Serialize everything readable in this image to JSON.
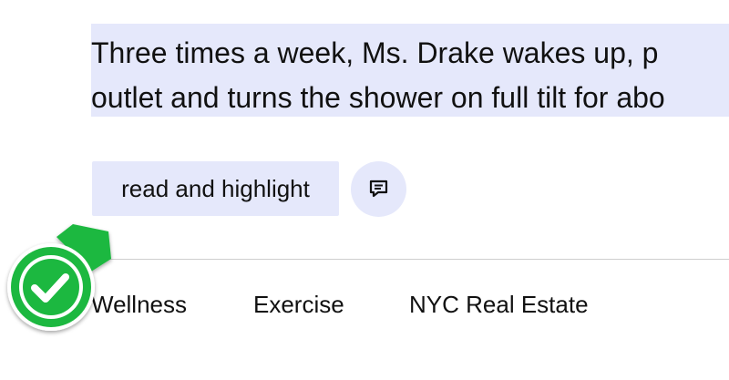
{
  "article": {
    "highlighted_lines": [
      "Three times a week, Ms. Drake wakes up, p",
      "outlet and turns the shower on full tilt for abo"
    ]
  },
  "actions": {
    "read_highlight_label": "read and highlight",
    "comment_icon": "comment-icon"
  },
  "tags": [
    {
      "label": "Wellness"
    },
    {
      "label": "Exercise"
    },
    {
      "label": "NYC Real Estate"
    }
  ],
  "badge": {
    "icon": "check-badge-icon",
    "color": "#1db83f"
  },
  "colors": {
    "highlight": "#e5e8fb",
    "divider": "#cfcfcf",
    "text": "#111111"
  }
}
